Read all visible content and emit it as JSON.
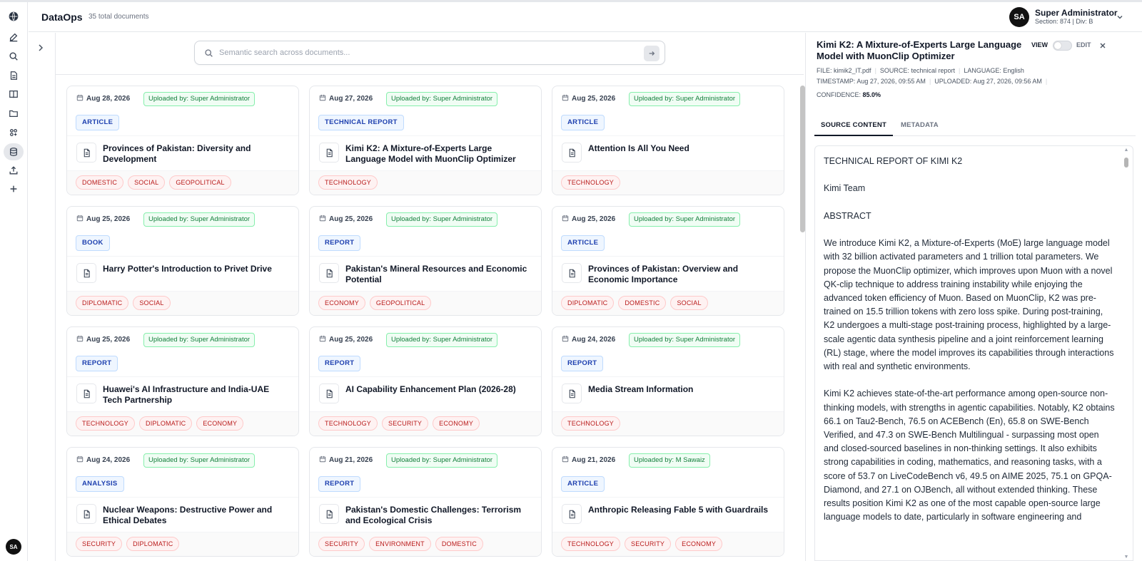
{
  "app": {
    "brand": "DataOps",
    "doc_count": "35 total documents"
  },
  "user": {
    "initials": "SA",
    "name": "Super Administrator",
    "sub": "Section: 874 | Div: B"
  },
  "rail": {
    "icons": [
      "logo-globe-icon",
      "edit-icon",
      "search-icon",
      "documents-icon",
      "book-icon",
      "folder-icon",
      "apps-icon",
      "database-icon",
      "upload-icon",
      "plus-icon"
    ],
    "avatar": "SA"
  },
  "search": {
    "placeholder": "Semantic search across documents..."
  },
  "cards": [
    {
      "date": "Aug 28, 2026",
      "uploader": "Uploaded by: Super Administrator",
      "type": "ARTICLE",
      "title": "Provinces of Pakistan: Diversity and Development",
      "tags": [
        "DOMESTIC",
        "SOCIAL",
        "GEOPOLITICAL"
      ]
    },
    {
      "date": "Aug 27, 2026",
      "uploader": "Uploaded by: Super Administrator",
      "type": "TECHNICAL REPORT",
      "title": "Kimi K2: A Mixture-of-Experts Large Language Model with MuonClip Optimizer",
      "tags": [
        "TECHNOLOGY"
      ]
    },
    {
      "date": "Aug 25, 2026",
      "uploader": "Uploaded by: Super Administrator",
      "type": "ARTICLE",
      "title": "Attention Is All You Need",
      "tags": [
        "TECHNOLOGY"
      ]
    },
    {
      "date": "Aug 25, 2026",
      "uploader": "Uploaded by: Super Administrator",
      "type": "BOOK",
      "title": "Harry Potter's Introduction to Privet Drive",
      "tags": [
        "DIPLOMATIC",
        "SOCIAL"
      ]
    },
    {
      "date": "Aug 25, 2026",
      "uploader": "Uploaded by: Super Administrator",
      "type": "REPORT",
      "title": "Pakistan's Mineral Resources and Economic Potential",
      "tags": [
        "ECONOMY",
        "GEOPOLITICAL"
      ]
    },
    {
      "date": "Aug 25, 2026",
      "uploader": "Uploaded by: Super Administrator",
      "type": "ARTICLE",
      "title": "Provinces of Pakistan: Overview and Economic Importance",
      "tags": [
        "DIPLOMATIC",
        "DOMESTIC",
        "SOCIAL"
      ]
    },
    {
      "date": "Aug 25, 2026",
      "uploader": "Uploaded by: Super Administrator",
      "type": "REPORT",
      "title": "Huawei's AI Infrastructure and India-UAE Tech Partnership",
      "tags": [
        "TECHNOLOGY",
        "DIPLOMATIC",
        "ECONOMY"
      ]
    },
    {
      "date": "Aug 25, 2026",
      "uploader": "Uploaded by: Super Administrator",
      "type": "REPORT",
      "title": "AI Capability Enhancement Plan (2026-28)",
      "tags": [
        "TECHNOLOGY",
        "SECURITY",
        "ECONOMY"
      ]
    },
    {
      "date": "Aug 24, 2026",
      "uploader": "Uploaded by: Super Administrator",
      "type": "REPORT",
      "title": "Media Stream Information",
      "tags": [
        "TECHNOLOGY"
      ]
    },
    {
      "date": "Aug 24, 2026",
      "uploader": "Uploaded by: Super Administrator",
      "type": "ANALYSIS",
      "title": "Nuclear Weapons: Destructive Power and Ethical Debates",
      "tags": [
        "SECURITY",
        "DIPLOMATIC"
      ]
    },
    {
      "date": "Aug 21, 2026",
      "uploader": "Uploaded by: Super Administrator",
      "type": "REPORT",
      "title": "Pakistan's Domestic Challenges: Terrorism and Ecological Crisis",
      "tags": [
        "SECURITY",
        "ENVIRONMENT",
        "DOMESTIC"
      ]
    },
    {
      "date": "Aug 21, 2026",
      "uploader": "Uploaded by: M Sawaiz",
      "type": "ARTICLE",
      "title": "Anthropic Releasing Fable 5 with Guardrails",
      "tags": [
        "TECHNOLOGY",
        "SECURITY",
        "ECONOMY"
      ]
    }
  ],
  "detail": {
    "title": "Kimi K2: A Mixture-of-Experts Large Language Model with MuonClip Optimizer",
    "view_label": "VIEW",
    "edit_label": "EDIT",
    "file_label": "FILE:",
    "file": "kimik2_IT.pdf",
    "source_label": "SOURCE:",
    "source": "technical report",
    "language_label": "LANGUAGE:",
    "language": "English",
    "timestamp_label": "TIMESTAMP:",
    "timestamp": "Aug 27, 2026, 09:55 AM",
    "uploaded_label": "UPLOADED:",
    "uploaded": "Aug 27, 2026, 09:56 AM",
    "confidence_label": "CONFIDENCE:",
    "confidence": "85.0%",
    "tabs": [
      "SOURCE CONTENT",
      "METADATA"
    ],
    "content": [
      "TECHNICAL REPORT OF KIMI K2",
      "Kimi Team",
      "ABSTRACT",
      "We introduce Kimi K2, a Mixture-of-Experts (MoE) large language model with 32 billion activated parameters and 1 trillion total parameters. We propose the MuonClip optimizer, which improves upon Muon with a novel QK-clip technique to address training instability while enjoying the advanced token efficiency of Muon. Based on MuonClip, K2 was pre-trained on 15.5 trillion tokens with zero loss spike. During post-training, K2 undergoes a multi-stage post-training process, highlighted by a large-scale agentic data synthesis pipeline and a joint reinforcement learning (RL) stage, where the model improves its capabilities through interactions with real and synthetic environments.",
      "Kimi K2 achieves state-of-the-art performance among open-source non-thinking models, with strengths in agentic capabilities. Notably, K2 obtains 66.1 on Tau2-Bench, 76.5 on ACEBench (En), 65.8 on SWE-Bench Verified, and 47.3 on SWE-Bench Multilingual - surpassing most open and closed-sourced baselines in non-thinking settings. It also exhibits strong capabilities in coding, mathematics, and reasoning tasks, with a score of 53.7 on LiveCodeBench v6, 49.5 on AIME 2025, 75.1 on GPQA-Diamond, and 27.1 on OJBench, all without extended thinking. These results position Kimi K2 as one of the most capable open-source large language models to date, particularly in software engineering and"
    ]
  }
}
